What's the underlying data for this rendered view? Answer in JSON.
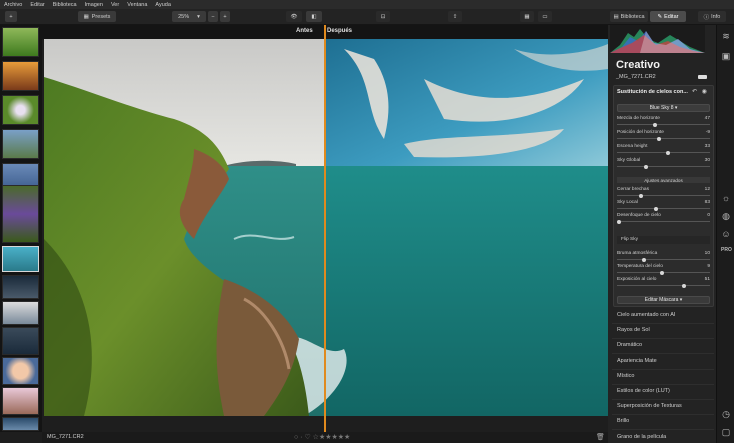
{
  "menu": [
    "Archivo",
    "Editar",
    "Biblioteca",
    "Imagen",
    "Ver",
    "Ventana",
    "Ayuda"
  ],
  "toolbar": {
    "add_label": "+",
    "presets_label": "Presets",
    "zoom_value": "25%",
    "zoom_minus": "−",
    "zoom_plus": "+",
    "library_tab": "Biblioteca",
    "edit_tab": "Editar",
    "info_tab": "Info"
  },
  "view": {
    "before_label": "Antes",
    "after_label": "Después",
    "filename": "MG_7271.CR2",
    "rating_text": "○ · ♡ ☆★★★★★"
  },
  "panel": {
    "title": "Creativo",
    "file": "_MG_7271.CR2",
    "card_title": "Sustitución de cielos con...",
    "sky_select": "Blue Sky 8 ▾",
    "sliders": [
      {
        "label": "Mezcla de horizonte",
        "value": "47",
        "pos": 0.4
      },
      {
        "label": "Posición del horizonte",
        "value": "-9",
        "pos": 0.45
      },
      {
        "label": "Escena height",
        "value": "33",
        "pos": 0.55
      },
      {
        "label": "Sky Global",
        "value": "30",
        "pos": 0.3
      }
    ],
    "advanced_label": "Ajustes avanzados",
    "advanced_sliders": [
      {
        "label": "Cerrar brechas",
        "value": "12",
        "pos": 0.25
      },
      {
        "label": "Sky Local",
        "value": "83",
        "pos": 0.42
      },
      {
        "label": "Desenfoque de cielo",
        "value": "0",
        "pos": 0.0
      }
    ],
    "flip_label": "Flip Sky",
    "post_sliders": [
      {
        "label": "Bruma atmosférica",
        "value": "10",
        "pos": 0.28
      },
      {
        "label": "Temperatura del cielo",
        "value": "9",
        "pos": 0.48
      },
      {
        "label": "Exposición al cielo",
        "value": "51",
        "pos": 0.73
      }
    ],
    "mask_button": "Editar Máscara ▾",
    "filters": [
      "Cielo aumentado con AI",
      "Rayos de Sol",
      "Dramático",
      "Apariencia Mate",
      "Místico",
      "Estilos de color (LUT)",
      "Superposición de Texturas",
      "Brillo",
      "Grano de la película"
    ]
  },
  "rail": {
    "pro_label": "PRO"
  },
  "colors": {
    "accent": "#e08a1e",
    "panel": "#232323",
    "card": "#2c2c2c"
  }
}
